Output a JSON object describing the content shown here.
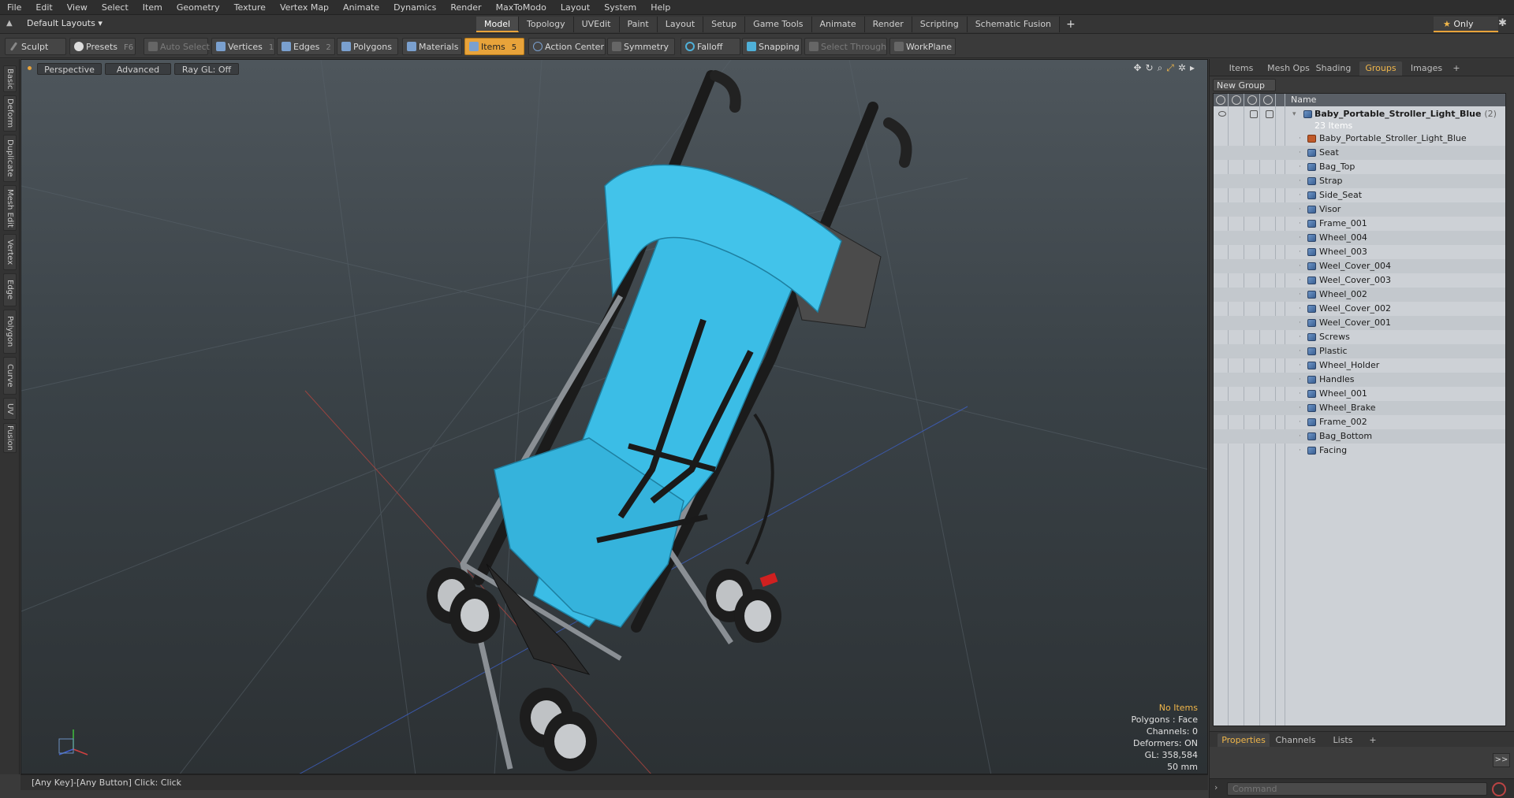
{
  "menu": [
    "File",
    "Edit",
    "View",
    "Select",
    "Item",
    "Geometry",
    "Texture",
    "Vertex Map",
    "Animate",
    "Dynamics",
    "Render",
    "MaxToModo",
    "Layout",
    "System",
    "Help"
  ],
  "layoutbar": {
    "layout_dropdown": "Default Layouts",
    "tabs": [
      "Model",
      "Topology",
      "UVEdit",
      "Paint",
      "Layout",
      "Setup",
      "Game Tools",
      "Animate",
      "Render",
      "Scripting",
      "Schematic Fusion"
    ],
    "active_tab": "Model",
    "add_tab": "+",
    "only_label": "Only"
  },
  "toolbar": {
    "sculpt": "Sculpt",
    "presets": "Presets",
    "presets_key": "F6",
    "auto_select": "Auto Select",
    "vertices": "Vertices",
    "vertices_key": "1",
    "edges": "Edges",
    "edges_key": "2",
    "polygons": "Polygons",
    "materials": "Materials",
    "items": "Items",
    "items_key": "5",
    "action_center": "Action Center",
    "symmetry": "Symmetry",
    "falloff": "Falloff",
    "snapping": "Snapping",
    "select_through": "Select Through",
    "workplane": "WorkPlane"
  },
  "left_tabs": [
    "Basic",
    "Deform",
    "Duplicate",
    "Mesh Edit",
    "Vertex",
    "Edge",
    "Polygon",
    "Curve",
    "UV",
    "Fusion"
  ],
  "viewport": {
    "view_mode": "Perspective",
    "shading": "Advanced",
    "raygl": "Ray GL: Off",
    "info": {
      "selection": "No Items",
      "polygons": "Polygons : Face",
      "channels": "Channels: 0",
      "deformers": "Deformers: ON",
      "gl": "GL: 358,584",
      "scale": "50 mm"
    }
  },
  "status": "[Any Key]-[Any Button] Click:  Click",
  "right_panel": {
    "tabs": [
      "Items",
      "Mesh Ops",
      "Shading",
      "Groups",
      "Images"
    ],
    "active_tab": "Groups",
    "add_tab": "+",
    "new_group": "New Group",
    "tree_header": "Name",
    "root": {
      "name": "Baby_Portable_Stroller_Light_Blue",
      "count": "(2)",
      "sub": "23 Items"
    },
    "children": [
      "Baby_Portable_Stroller_Light_Blue",
      "Seat",
      "Bag_Top",
      "Strap",
      "Side_Seat",
      "Visor",
      "Frame_001",
      "Wheel_004",
      "Wheel_003",
      "Weel_Cover_004",
      "Weel_Cover_003",
      "Wheel_002",
      "Weel_Cover_002",
      "Weel_Cover_001",
      "Screws",
      "Plastic",
      "Wheel_Holder",
      "Handles",
      "Wheel_001",
      "Wheel_Brake",
      "Frame_002",
      "Bag_Bottom",
      "Facing"
    ],
    "bottom_tabs": [
      "Properties",
      "Channels",
      "Lists"
    ],
    "bottom_active": "Properties",
    "bottom_add": "+",
    "expand": ">>",
    "command_placeholder": "Command"
  },
  "colors": {
    "accent": "#e8a33a",
    "model_cyan": "#3bbde6",
    "viewport_bg": "#3a4247"
  },
  "icons": [
    "gear-icon",
    "star-icon",
    "move-icon",
    "rotate-icon",
    "zoom-icon",
    "maximize-icon",
    "settings-icon",
    "eye-icon",
    "lock-icon",
    "mesh-icon"
  ]
}
